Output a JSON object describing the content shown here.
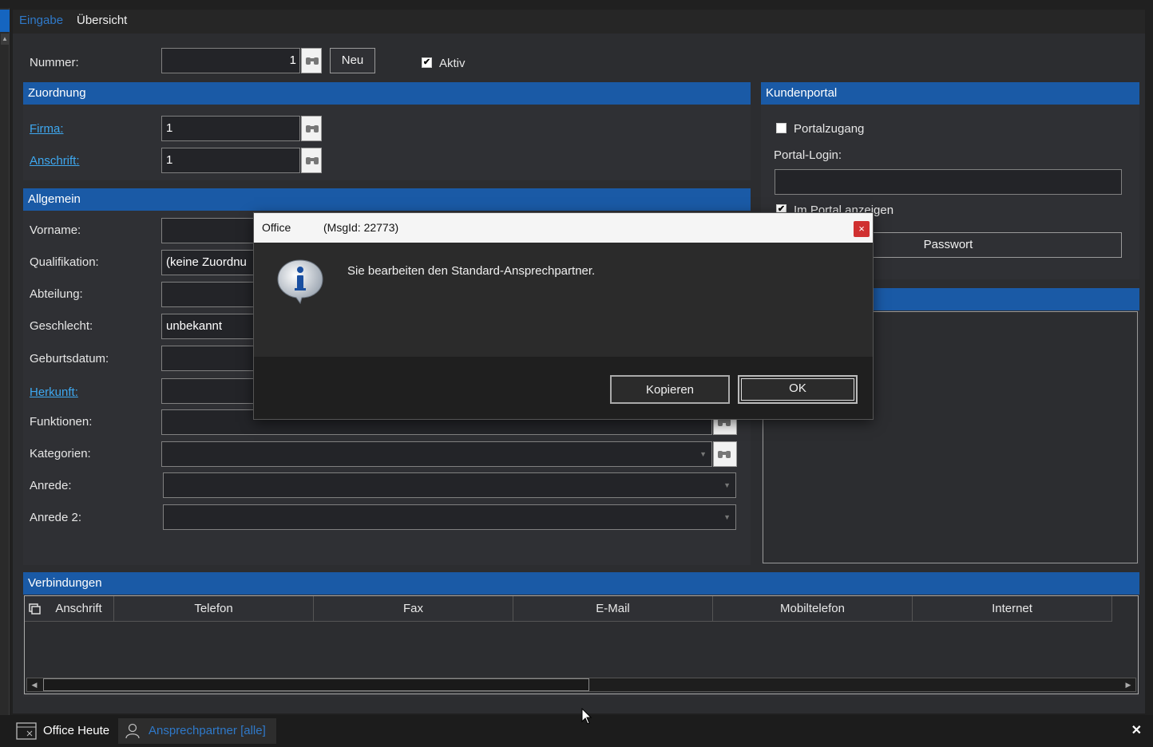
{
  "tabs": {
    "eingabe": "Eingabe",
    "uebersicht": "Übersicht"
  },
  "header_form": {
    "nummer_label": "Nummer:",
    "nummer_value": "1",
    "neu_button": "Neu",
    "aktiv_label": "Aktiv",
    "aktiv_checked": true
  },
  "zuordnung": {
    "title": "Zuordnung",
    "firma_label": "Firma:",
    "firma_value": "1",
    "anschrift_label": "Anschrift:",
    "anschrift_value": "1"
  },
  "allgemein": {
    "title": "Allgemein",
    "vorname_label": "Vorname:",
    "vorname_value": "",
    "qualifikation_label": "Qualifikation:",
    "qualifikation_value": "(keine Zuordnu",
    "abteilung_label": "Abteilung:",
    "abteilung_value": "",
    "geschlecht_label": "Geschlecht:",
    "geschlecht_value": "unbekannt",
    "geburtsdatum_label": "Geburtsdatum:",
    "geburtsdatum_value": "",
    "herkunft_label": "Herkunft:",
    "herkunft_value": "",
    "funktionen_label": "Funktionen:",
    "funktionen_value": "",
    "kategorien_label": "Kategorien:",
    "kategorien_value": "",
    "anrede_label": "Anrede:",
    "anrede_value": "",
    "anrede2_label": "Anrede 2:",
    "anrede2_value": ""
  },
  "kundenportal": {
    "title": "Kundenportal",
    "portalzugang_label": "Portalzugang",
    "portalzugang_checked": false,
    "portal_login_label": "Portal-Login:",
    "portal_login_value": "",
    "im_portal_label": "Im Portal anzeigen",
    "im_portal_checked": true,
    "passwort_button": "Passwort"
  },
  "verbindungen": {
    "title": "Verbindungen",
    "columns": [
      "Anschrift",
      "Telefon",
      "Fax",
      "E-Mail",
      "Mobiltelefon",
      "Internet"
    ]
  },
  "bottom": {
    "office_heute": "Office Heute",
    "ansprechpartner": "Ansprechpartner [alle]",
    "close_glyph": "✕"
  },
  "dialog": {
    "title": "Office",
    "msg_id": "(MsgId: 22773)",
    "message": "Sie bearbeiten den Standard-Ansprechpartner.",
    "kopieren_button": "Kopieren",
    "ok_button": "OK",
    "close_glyph": "×"
  },
  "colors": {
    "accent": "#1a5aa6",
    "link": "#3ea8f0",
    "tab_active": "#2f79c9"
  }
}
